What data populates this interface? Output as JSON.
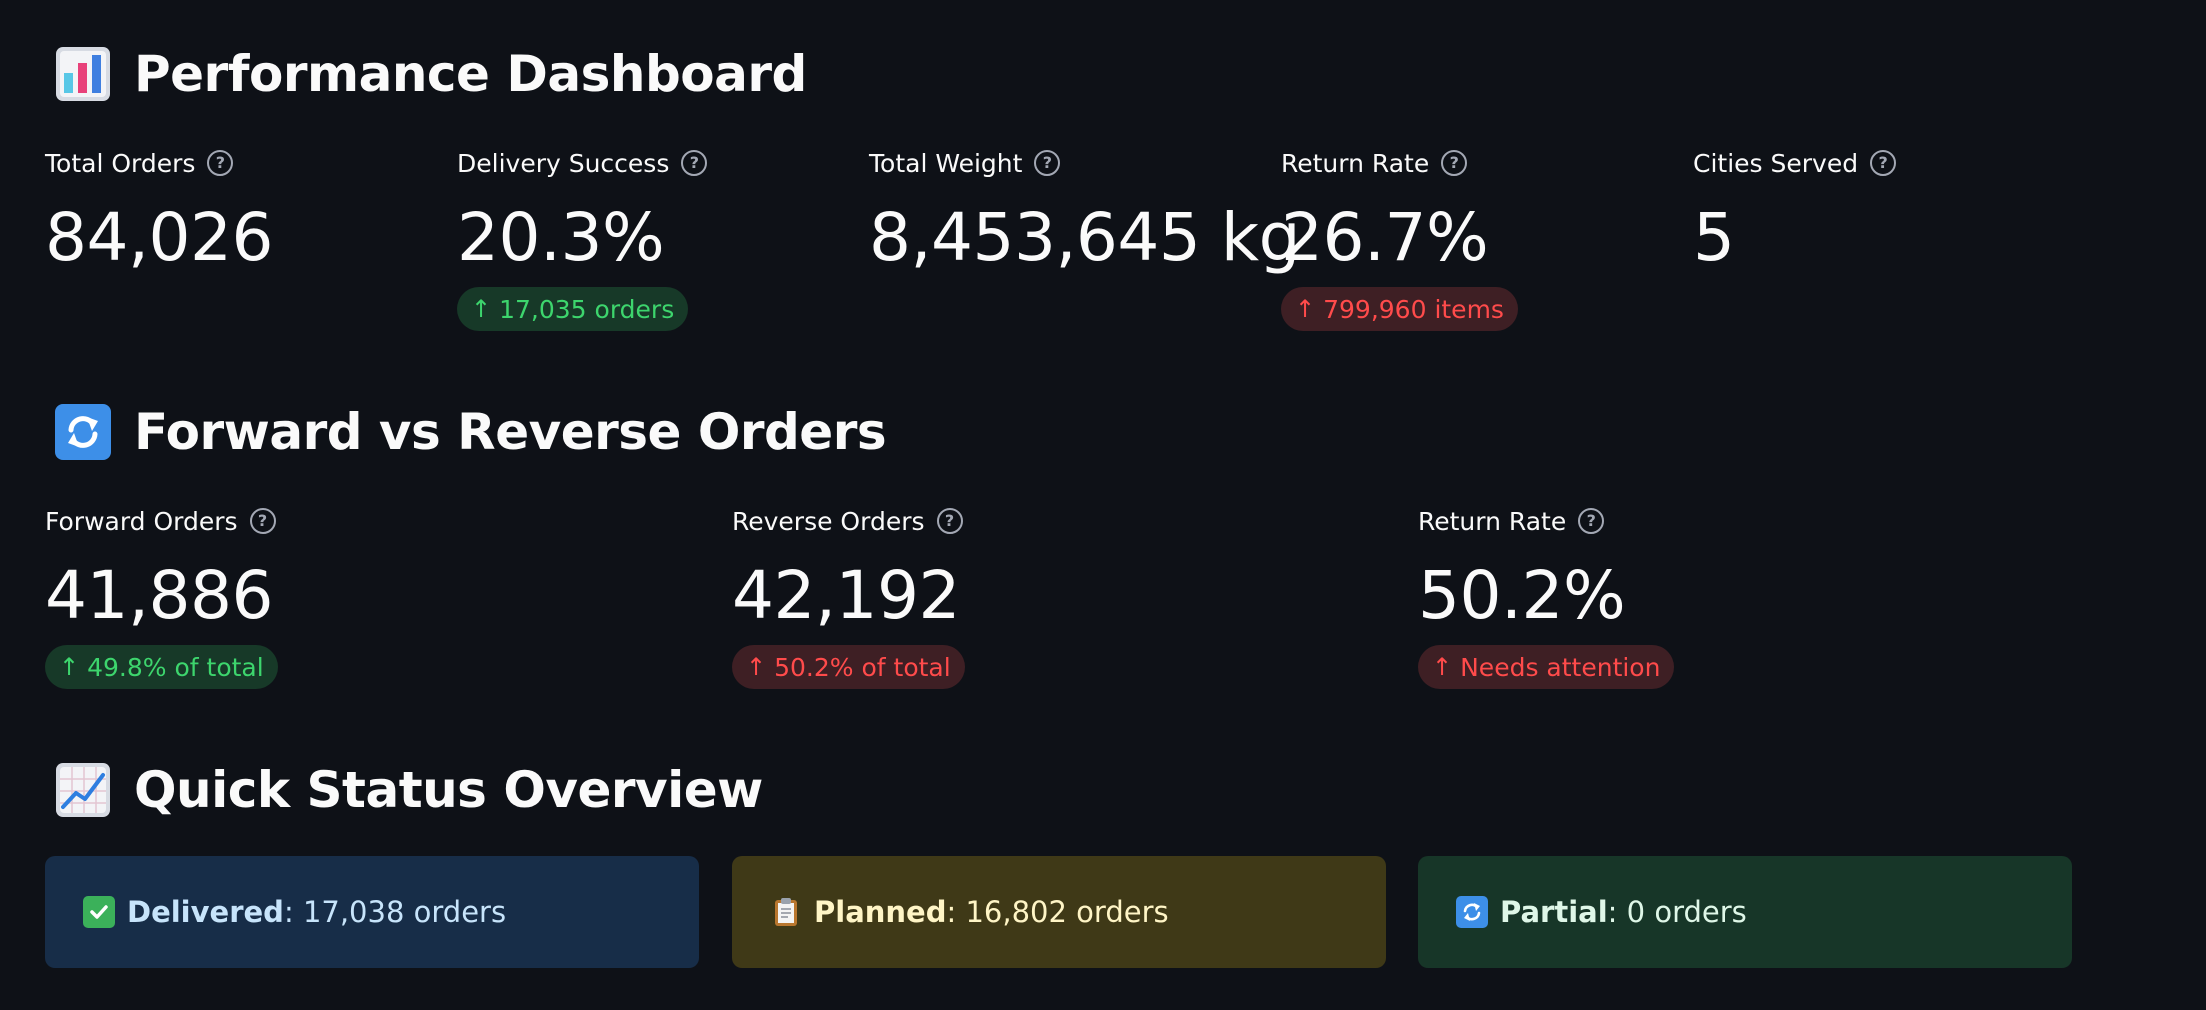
{
  "sections": {
    "performance_title": "Performance Dashboard",
    "forward_reverse_title": "Forward vs Reverse Orders",
    "quick_status_title": "Quick Status Overview"
  },
  "performance_metrics": [
    {
      "label": "Total Orders",
      "value": "84,026"
    },
    {
      "label": "Delivery Success",
      "value": "20.3%",
      "delta": "17,035 orders",
      "delta_status": "positive"
    },
    {
      "label": "Total Weight",
      "value": "8,453,645 kg"
    },
    {
      "label": "Return Rate",
      "value": "26.7%",
      "delta": "799,960 items",
      "delta_status": "negative"
    },
    {
      "label": "Cities Served",
      "value": "5"
    }
  ],
  "forward_reverse_metrics": [
    {
      "label": "Forward Orders",
      "value": "41,886",
      "delta": "49.8% of total",
      "delta_status": "positive"
    },
    {
      "label": "Reverse Orders",
      "value": "42,192",
      "delta": "50.2% of total",
      "delta_status": "negative"
    },
    {
      "label": "Return Rate",
      "value": "50.2%",
      "delta": "Needs attention",
      "delta_status": "negative"
    }
  ],
  "status_cards": [
    {
      "label": "Delivered",
      "text": "17,038 orders",
      "icon": "check-mark-icon"
    },
    {
      "label": "Planned",
      "text": "16,802 orders",
      "icon": "clipboard-icon"
    },
    {
      "label": "Partial",
      "text": "0 orders",
      "icon": "arrows-cycle-icon"
    }
  ],
  "help_glyph": "?",
  "up_arrow_glyph": "↑",
  "colors": {
    "background": "#0e1117",
    "positive_text": "#3dd56d",
    "positive_bg": "#173928",
    "negative_text": "#ff4b4b",
    "negative_bg": "#3e1f24",
    "card_blue": "#172d48",
    "card_yellow": "#3f3917",
    "card_green": "#173628"
  }
}
